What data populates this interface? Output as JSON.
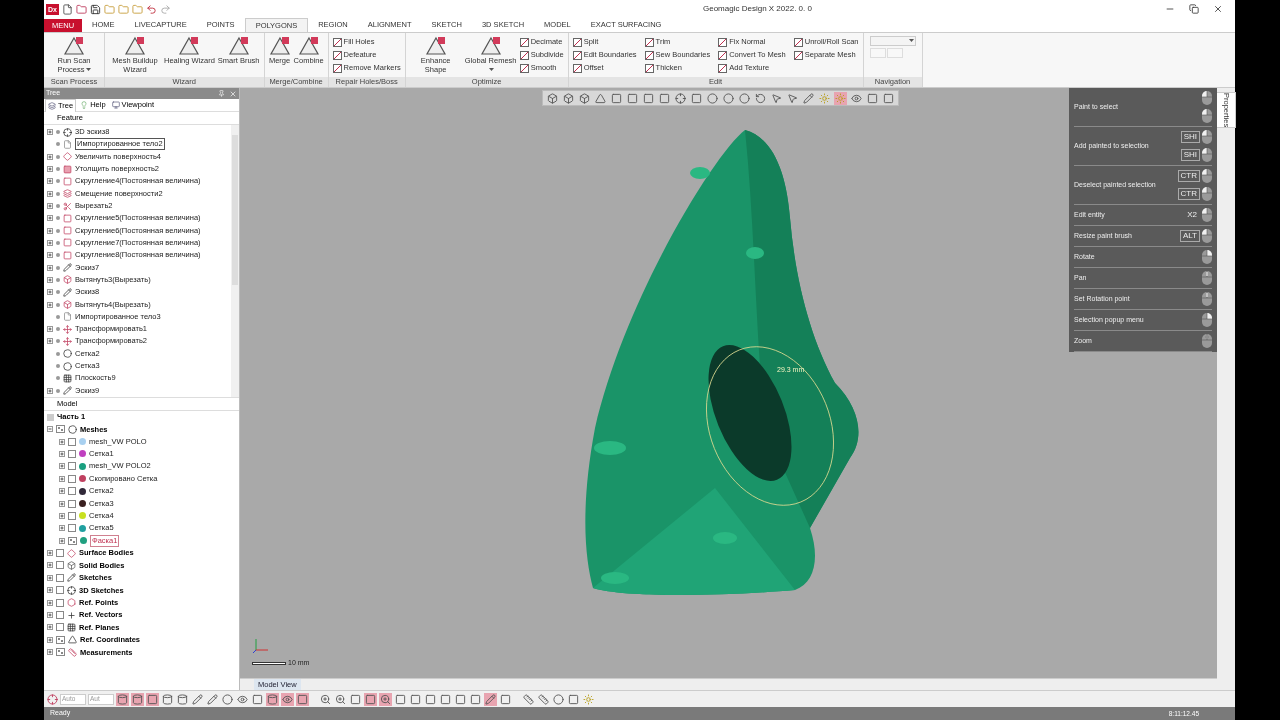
{
  "app": {
    "logo": "Dx",
    "title": "Geomagic Design X 2022. 0. 0"
  },
  "menu_button": "MENU",
  "tabs": [
    {
      "label": "HOME",
      "selected": false
    },
    {
      "label": "LIVECAPTURE",
      "selected": false
    },
    {
      "label": "POINTS",
      "selected": false
    },
    {
      "label": "POLYGONS",
      "selected": true
    },
    {
      "label": "REGION",
      "selected": false
    },
    {
      "label": "ALIGNMENT",
      "selected": false
    },
    {
      "label": "SKETCH",
      "selected": false
    },
    {
      "label": "3D SKETCH",
      "selected": false
    },
    {
      "label": "MODEL",
      "selected": false
    },
    {
      "label": "EXACT SURFACING",
      "selected": false
    }
  ],
  "ribbon": [
    {
      "label": "Scan Process",
      "items": [
        {
          "kind": "large",
          "label": "Run Scan Process",
          "dropdown": true
        }
      ]
    },
    {
      "label": "Wizard",
      "items": [
        {
          "kind": "large",
          "label": "Mesh Buildup Wizard",
          "dropdown": false
        },
        {
          "kind": "large",
          "label": "Healing Wizard",
          "dropdown": false
        },
        {
          "kind": "large",
          "label": "Smart Brush",
          "dropdown": false
        }
      ]
    },
    {
      "label": "Merge/Combine",
      "items": [
        {
          "kind": "large",
          "label": "Merge",
          "dropdown": false
        },
        {
          "kind": "large",
          "label": "Combine",
          "dropdown": false
        }
      ]
    },
    {
      "label": "Repair Holes/Boss",
      "items": [
        {
          "kind": "small",
          "label": "Fill Holes",
          "dropdown": false
        },
        {
          "kind": "small",
          "label": "Defeature",
          "dropdown": false
        },
        {
          "kind": "small",
          "label": "Remove Markers",
          "dropdown": false
        }
      ]
    },
    {
      "label": "Optimize",
      "items": [
        {
          "kind": "large",
          "label": "Enhance Shape",
          "dropdown": false
        },
        {
          "kind": "large",
          "label": "Global Remesh",
          "dropdown": true
        },
        {
          "kind": "small",
          "label": "Decimate",
          "dropdown": false
        },
        {
          "kind": "small",
          "label": "Subdivide",
          "dropdown": false
        },
        {
          "kind": "small",
          "label": "Smooth",
          "dropdown": false
        }
      ]
    },
    {
      "label": "Edit",
      "items": [
        {
          "kind": "small",
          "label": "Split",
          "dropdown": false
        },
        {
          "kind": "small",
          "label": "Edit Boundaries",
          "dropdown": false
        },
        {
          "kind": "small",
          "label": "Offset",
          "dropdown": false
        },
        {
          "kind": "small",
          "label": "Trim",
          "dropdown": false
        },
        {
          "kind": "small",
          "label": "Sew Boundaries",
          "dropdown": false
        },
        {
          "kind": "small",
          "label": "Thicken",
          "dropdown": false
        },
        {
          "kind": "small",
          "label": "Fix Normal",
          "dropdown": false
        },
        {
          "kind": "small",
          "label": "Convert To Mesh",
          "dropdown": false
        },
        {
          "kind": "small",
          "label": "Add Texture",
          "dropdown": false
        },
        {
          "kind": "small",
          "label": "Unroll/Roll Scan",
          "dropdown": false
        },
        {
          "kind": "small",
          "label": "Separate Mesh",
          "dropdown": false
        }
      ]
    },
    {
      "label": "Navigation",
      "items": [
        {
          "kind": "navigation",
          "dropdown": true
        }
      ]
    }
  ],
  "tree_panel": {
    "title": "Tree",
    "tabs": [
      {
        "label": "Tree",
        "selected": true
      },
      {
        "label": "Help",
        "selected": false
      },
      {
        "label": "Viewpoint",
        "selected": false
      }
    ],
    "feature_header": "Feature",
    "features": [
      {
        "label": "3D эскиз8",
        "kind": "sketch3d",
        "expandable": true,
        "selected": false
      },
      {
        "label": "Импортированное тело2",
        "kind": "imported",
        "expandable": false,
        "selected": true
      },
      {
        "label": "Увеличить поверхность4",
        "kind": "surface",
        "expandable": true,
        "selected": false
      },
      {
        "label": "Утолщить поверхность2",
        "kind": "thicken",
        "expandable": true,
        "selected": false
      },
      {
        "label": "Скругление4(Постоянная величина)",
        "kind": "fillet",
        "expandable": true,
        "selected": false
      },
      {
        "label": "Смещение поверхности2",
        "kind": "offset",
        "expandable": true,
        "selected": false
      },
      {
        "label": "Вырезать2",
        "kind": "cut",
        "expandable": true,
        "selected": false
      },
      {
        "label": "Скругление5(Постоянная величина)",
        "kind": "fillet",
        "expandable": true,
        "selected": false
      },
      {
        "label": "Скругление6(Постоянная величина)",
        "kind": "fillet",
        "expandable": true,
        "selected": false
      },
      {
        "label": "Скругление7(Постоянная величина)",
        "kind": "fillet",
        "expandable": true,
        "selected": false
      },
      {
        "label": "Скругление8(Постоянная величина)",
        "kind": "fillet",
        "expandable": true,
        "selected": false
      },
      {
        "label": "Эскиз7",
        "kind": "sketch",
        "expandable": true,
        "selected": false
      },
      {
        "label": "Вытянуть3(Вырезать)",
        "kind": "extrude",
        "expandable": true,
        "selected": false
      },
      {
        "label": "Эскиз8",
        "kind": "sketch",
        "expandable": true,
        "selected": false
      },
      {
        "label": "Вытянуть4(Вырезать)",
        "kind": "extrude",
        "expandable": true,
        "selected": false
      },
      {
        "label": "Импортированное тело3",
        "kind": "imported",
        "expandable": false,
        "selected": false
      },
      {
        "label": "Трансформировать1",
        "kind": "transform",
        "expandable": true,
        "selected": false
      },
      {
        "label": "Трансформировать2",
        "kind": "transform",
        "expandable": true,
        "selected": false
      },
      {
        "label": "Сетка2",
        "kind": "mesh",
        "expandable": false,
        "selected": false
      },
      {
        "label": "Сетка3",
        "kind": "mesh",
        "expandable": false,
        "selected": false
      },
      {
        "label": "Плоскость9",
        "kind": "plane",
        "expandable": false,
        "selected": false
      },
      {
        "label": "Эскиз9",
        "kind": "sketch",
        "expandable": true,
        "selected": false
      }
    ],
    "model_header": "Model",
    "part": "Часть 1",
    "model": [
      {
        "label": "Meshes",
        "kind": "mesh",
        "expanded": true,
        "visible": true,
        "children": [
          {
            "label": "mesh_VW POLO",
            "color": "#a8d0f0",
            "expanded": false,
            "visible": false,
            "selected": false
          },
          {
            "label": "Сетка1",
            "color": "#c040c0",
            "expanded": false,
            "visible": false,
            "selected": false
          },
          {
            "label": "mesh_VW POLO2",
            "color": "#1aa080",
            "expanded": false,
            "visible": false,
            "selected": false
          },
          {
            "label": "Скопировано Сетка",
            "color": "#c04060",
            "expanded": false,
            "visible": false,
            "selected": false
          },
          {
            "label": "Сетка2",
            "color": "#302838",
            "expanded": false,
            "visible": false,
            "selected": false
          },
          {
            "label": "Сетка3",
            "color": "#3a2020",
            "expanded": false,
            "visible": false,
            "selected": false
          },
          {
            "label": "Сетка4",
            "color": "#c8e020",
            "expanded": false,
            "visible": false,
            "selected": false
          },
          {
            "label": "Сетка5",
            "color": "#20a0a0",
            "expanded": false,
            "visible": false,
            "selected": false
          },
          {
            "label": "Фаска1",
            "color": "#20a080",
            "expanded": false,
            "visible": true,
            "selected": true
          }
        ]
      },
      {
        "label": "Surface Bodies",
        "kind": "surface",
        "expanded": false,
        "visible": false
      },
      {
        "label": "Solid Bodies",
        "kind": "solid",
        "expanded": false,
        "visible": false
      },
      {
        "label": "Sketches",
        "kind": "sketch",
        "expanded": false,
        "visible": false
      },
      {
        "label": "3D Sketches",
        "kind": "sketch3d",
        "expanded": false,
        "visible": false
      },
      {
        "label": "Ref. Points",
        "kind": "points",
        "expanded": false,
        "visible": false
      },
      {
        "label": "Ref. Vectors",
        "kind": "vectors",
        "expanded": false,
        "visible": false
      },
      {
        "label": "Ref. Planes",
        "kind": "plane",
        "expanded": false,
        "visible": false
      },
      {
        "label": "Ref. Coordinates",
        "kind": "coords",
        "expanded": false,
        "visible": true
      },
      {
        "label": "Measurements",
        "kind": "measure",
        "expanded": false,
        "visible": true
      }
    ]
  },
  "viewport": {
    "dimension": "29.3 mm",
    "scale": "10 mm",
    "tab": "Model View"
  },
  "mouse_hints": [
    {
      "label": "Paint to select",
      "combos": [
        {
          "kind": "left"
        },
        {
          "kind": "left"
        }
      ]
    },
    {
      "label": "Add painted to selection",
      "combos": [
        {
          "kind": "left",
          "modifier": "SHI"
        },
        {
          "kind": "left",
          "modifier": "SHI"
        }
      ]
    },
    {
      "label": "Deselect painted selection",
      "combos": [
        {
          "kind": "left",
          "modifier": "CTR"
        },
        {
          "kind": "left",
          "modifier": "CTR"
        }
      ]
    },
    {
      "label": "Edit entity",
      "combos": [
        {
          "kind": "left",
          "multiplier": "X2"
        }
      ]
    },
    {
      "label": "Resize paint brush",
      "combos": [
        {
          "kind": "left",
          "modifier": "ALT"
        }
      ]
    },
    {
      "label": "Rotate",
      "combos": [
        {
          "kind": "right"
        }
      ]
    },
    {
      "label": "Pan",
      "combos": [
        {
          "kind": "middle"
        }
      ]
    },
    {
      "label": "Set Rotation point",
      "combos": [
        {
          "kind": "middle"
        }
      ]
    },
    {
      "label": "Selection popup menu",
      "combos": [
        {
          "kind": "right"
        }
      ]
    },
    {
      "label": "Zoom",
      "combos": [
        {
          "kind": "wheel"
        }
      ]
    }
  ],
  "properties_tab": "Properties",
  "bottom_toolbar": {
    "fields": [
      "Auto",
      "Aut"
    ]
  },
  "status_bar": {
    "text": "Ready",
    "time": "8:11:12.45"
  }
}
